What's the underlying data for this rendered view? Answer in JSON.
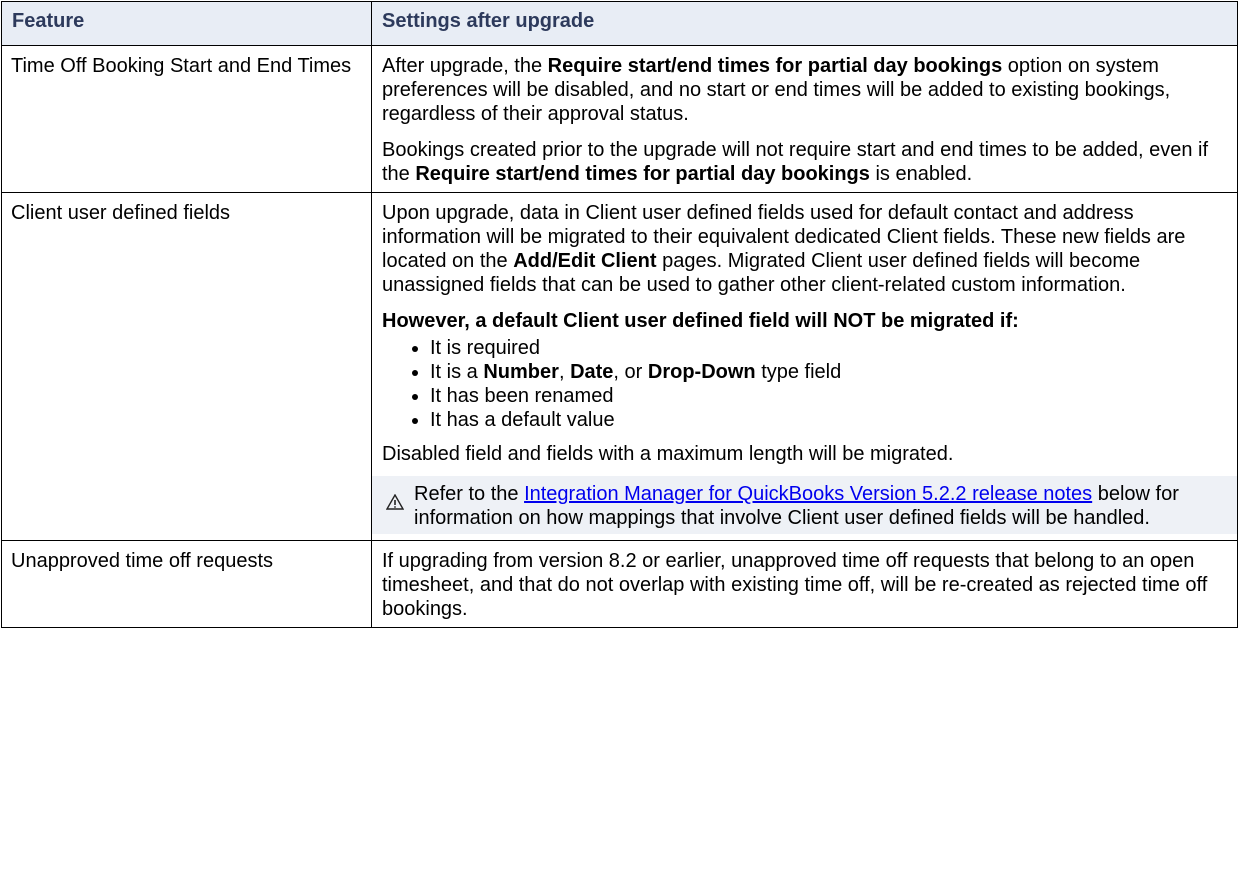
{
  "table": {
    "headers": [
      "Feature",
      "Settings after upgrade"
    ],
    "rows": [
      {
        "feature": "Time Off Booking Start and End Times",
        "p1": {
          "a": "After upgrade, the ",
          "b": "Require start/end times for partial day bookings",
          "c": " option on system preferences will be disabled, and no start or end times will be added to existing bookings, regardless of their approval status."
        },
        "p2": {
          "a": "Bookings created prior to the upgrade will not require start and end times to be added, even if the ",
          "b": "Require start/end times for partial day bookings",
          "c": " is enabled."
        }
      },
      {
        "feature": "Client user defined fields",
        "p1": {
          "a": "Upon upgrade, data in Client user defined fields used for default contact and address information will be migrated to their equivalent dedicated Client fields. These new fields are located on the ",
          "b": "Add/Edit Client",
          "c": " pages. Migrated Client user defined fields will become unassigned fields that can be used to gather other client-related custom information."
        },
        "heading": "However, a default Client user defined field will NOT be migrated if:",
        "bullets": {
          "b1": "It is required",
          "b2": {
            "a": "It is a ",
            "number": "Number",
            "sep1": ", ",
            "date": "Date",
            "sep2": ", or ",
            "dropdown": "Drop-Down",
            "c": " type field"
          },
          "b3": "It has been renamed",
          "b4": "It has a default value"
        },
        "p3": "Disabled field and fields with a maximum length will be migrated.",
        "note": {
          "icon": "warning-icon",
          "a": "Refer to the ",
          "link": "Integration Manager for QuickBooks Version 5.2.2 release notes",
          "c": " below for information on how mappings that involve Client user defined fields will be handled."
        }
      },
      {
        "feature": "Unapproved time off requests",
        "p1": "If upgrading from version 8.2 or earlier, unapproved time off requests that belong to an open timesheet, and that do not overlap with existing time off, will be re-created as rejected time off bookings."
      }
    ]
  },
  "colors": {
    "header_bg": "#e8edf5",
    "header_text": "#2d3a5c",
    "note_bg": "#eef1f6",
    "link": "#0000ee"
  }
}
